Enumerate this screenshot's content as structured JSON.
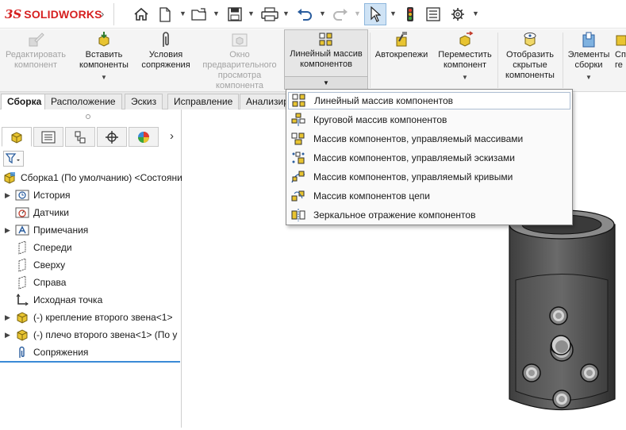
{
  "app": {
    "brand_prefix": "3S",
    "brand": "SOLIDWORKS"
  },
  "quick_access": {
    "icons": [
      "home-icon",
      "new-document-icon",
      "open-folder-icon",
      "save-icon",
      "print-icon",
      "undo-icon",
      "redo-icon",
      "select-cursor-icon",
      "traffic-light-icon",
      "properties-icon",
      "gear-icon"
    ]
  },
  "ribbon": {
    "edit_component": "Редактировать компонент",
    "insert_components": "Вставить компоненты",
    "mate": "Условия сопряжения",
    "preview_window": "Окно предварительного просмотра компонента",
    "linear_pattern": "Линейный массив компонентов",
    "smart_fasteners": "Автокрепежи",
    "move_component": "Переместить компонент",
    "show_hidden": "Отобразить скрытые компоненты",
    "assembly_features": "Элементы сборки",
    "next_partial_1": "Сп",
    "next_partial_2": "ге"
  },
  "tabs": [
    "Сборка",
    "Расположение",
    "Эскиз",
    "Исправление",
    "Анализир"
  ],
  "feature_tree": {
    "root": "Сборка1 (По умолчанию) <Состояни",
    "items": [
      {
        "label": "История",
        "expandable": true,
        "icon": "history-icon"
      },
      {
        "label": "Датчики",
        "expandable": false,
        "icon": "sensor-icon"
      },
      {
        "label": "Примечания",
        "expandable": true,
        "icon": "annotation-icon"
      },
      {
        "label": "Спереди",
        "expandable": false,
        "icon": "plane-icon"
      },
      {
        "label": "Сверху",
        "expandable": false,
        "icon": "plane-icon"
      },
      {
        "label": "Справа",
        "expandable": false,
        "icon": "plane-icon"
      },
      {
        "label": "Исходная точка",
        "expandable": false,
        "icon": "origin-icon"
      },
      {
        "label": "(-) крепление второго звена<1>",
        "expandable": true,
        "icon": "part-icon"
      },
      {
        "label": "(-) плечо второго звена<1> (По у",
        "expandable": true,
        "icon": "part-icon"
      },
      {
        "label": "Сопряжения",
        "expandable": false,
        "icon": "mates-icon"
      }
    ]
  },
  "pattern_menu": {
    "items": [
      "Линейный массив компонентов",
      "Круговой массив компонентов",
      "Массив компонентов, управляемый массивами",
      "Массив компонентов, управляемый эскизами",
      "Массив компонентов, управляемый кривыми",
      "Массив компонентов цепи",
      "Зеркальное отражение компонентов"
    ],
    "highlighted_index": 0
  },
  "colors": {
    "brand_red": "#d62020",
    "accent_blue": "#3a8ad6",
    "part_yellow": "#e8c431",
    "model_gray": "#5a5a5a"
  }
}
